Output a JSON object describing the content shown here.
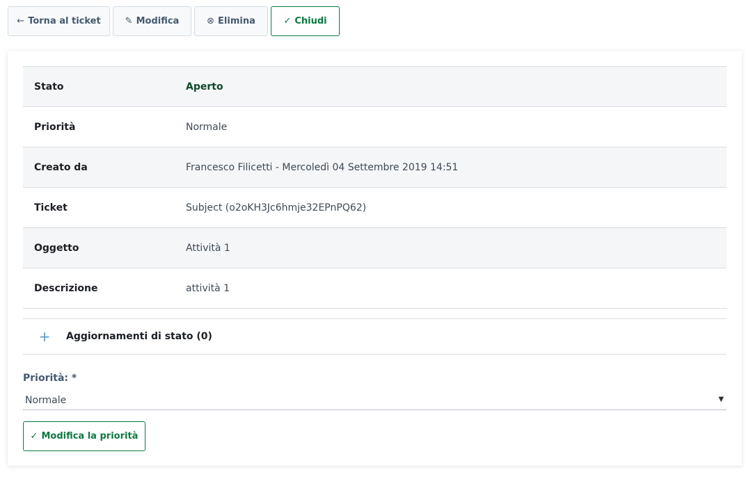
{
  "toolbar": {
    "back_label": "Torna al ticket",
    "edit_label": "Modifica",
    "delete_label": "Elimina",
    "close_label": "Chiudi"
  },
  "icons": {
    "back": "arrow-left-icon",
    "edit": "pencil-icon",
    "delete": "circle-x-icon",
    "close": "check-icon"
  },
  "details": {
    "rows": [
      {
        "key": "Stato",
        "value": "Aperto"
      },
      {
        "key": "Priorità",
        "value": "Normale"
      },
      {
        "key": "Creato da",
        "value": "Francesco Filicetti - Mercoledì 04 Settembre 2019 14:51"
      },
      {
        "key": "Ticket",
        "value": "Subject (o2oKH3Jc6hmje32EPnPQ62)"
      },
      {
        "key": "Oggetto",
        "value": "Attività 1"
      },
      {
        "key": "Descrizione",
        "value": "attività 1"
      }
    ]
  },
  "updates": {
    "label": "Aggiornamenti di stato (0)"
  },
  "priority_form": {
    "label": "Priorità: *",
    "selected": "Normale",
    "submit_label": "Modifica la priorità"
  },
  "colors": {
    "accent_green": "#0a7a3d",
    "status_green": "#0d4b2b",
    "plus_blue": "#5b9bd5"
  }
}
